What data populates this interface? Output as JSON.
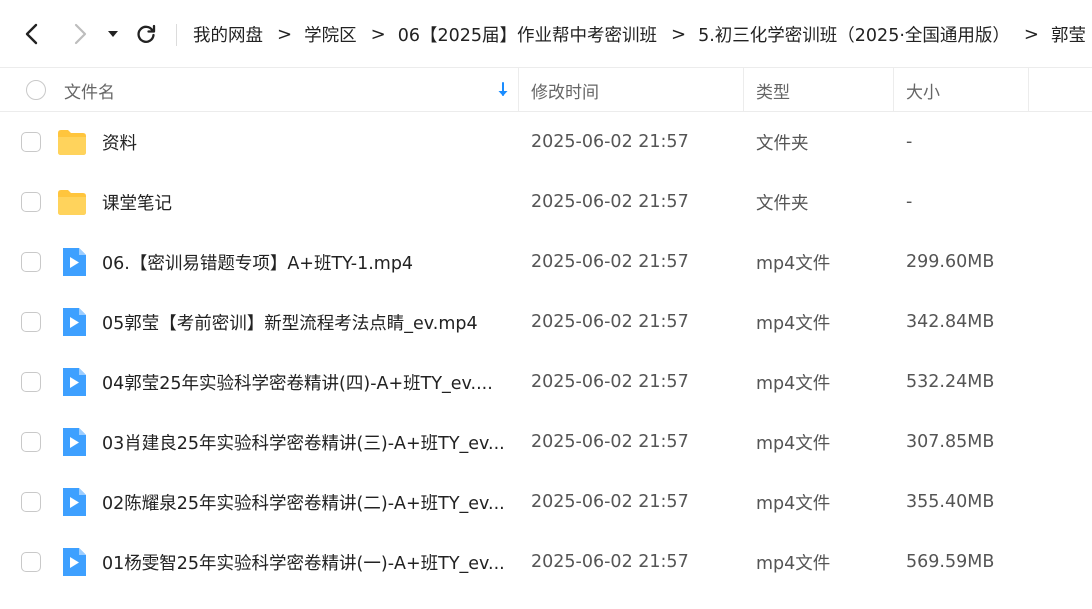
{
  "breadcrumb": {
    "items": [
      "我的网盘",
      "学院区",
      "06【2025届】作业帮中考密训班",
      "5.初三化学密训班（2025·全国通用版）",
      "郭莹"
    ]
  },
  "header": {
    "name": "文件名",
    "modified": "修改时间",
    "type": "类型",
    "size": "大小"
  },
  "colors": {
    "accent": "#1a8cff",
    "folder": "#ffc53d",
    "video": "#3ea0ff"
  },
  "files": [
    {
      "name": "资料",
      "modified": "2025-06-02 21:57",
      "type": "文件夹",
      "size": "-",
      "icon": "folder-icon"
    },
    {
      "name": "课堂笔记",
      "modified": "2025-06-02 21:57",
      "type": "文件夹",
      "size": "-",
      "icon": "folder-icon"
    },
    {
      "name": "06.【密训易错题专项】A+班TY-1.mp4",
      "modified": "2025-06-02 21:57",
      "type": "mp4文件",
      "size": "299.60MB",
      "icon": "video-file-icon"
    },
    {
      "name": "05郭莹【考前密训】新型流程考法点睛_ev.mp4",
      "modified": "2025-06-02 21:57",
      "type": "mp4文件",
      "size": "342.84MB",
      "icon": "video-file-icon"
    },
    {
      "name": "04郭莹25年实验科学密卷精讲(四)-A+班TY_ev....",
      "modified": "2025-06-02 21:57",
      "type": "mp4文件",
      "size": "532.24MB",
      "icon": "video-file-icon"
    },
    {
      "name": "03肖建良25年实验科学密卷精讲(三)-A+班TY_ev...",
      "modified": "2025-06-02 21:57",
      "type": "mp4文件",
      "size": "307.85MB",
      "icon": "video-file-icon"
    },
    {
      "name": "02陈耀泉25年实验科学密卷精讲(二)-A+班TY_ev...",
      "modified": "2025-06-02 21:57",
      "type": "mp4文件",
      "size": "355.40MB",
      "icon": "video-file-icon"
    },
    {
      "name": "01杨雯智25年实验科学密卷精讲(一)-A+班TY_ev...",
      "modified": "2025-06-02 21:57",
      "type": "mp4文件",
      "size": "569.59MB",
      "icon": "video-file-icon"
    }
  ]
}
